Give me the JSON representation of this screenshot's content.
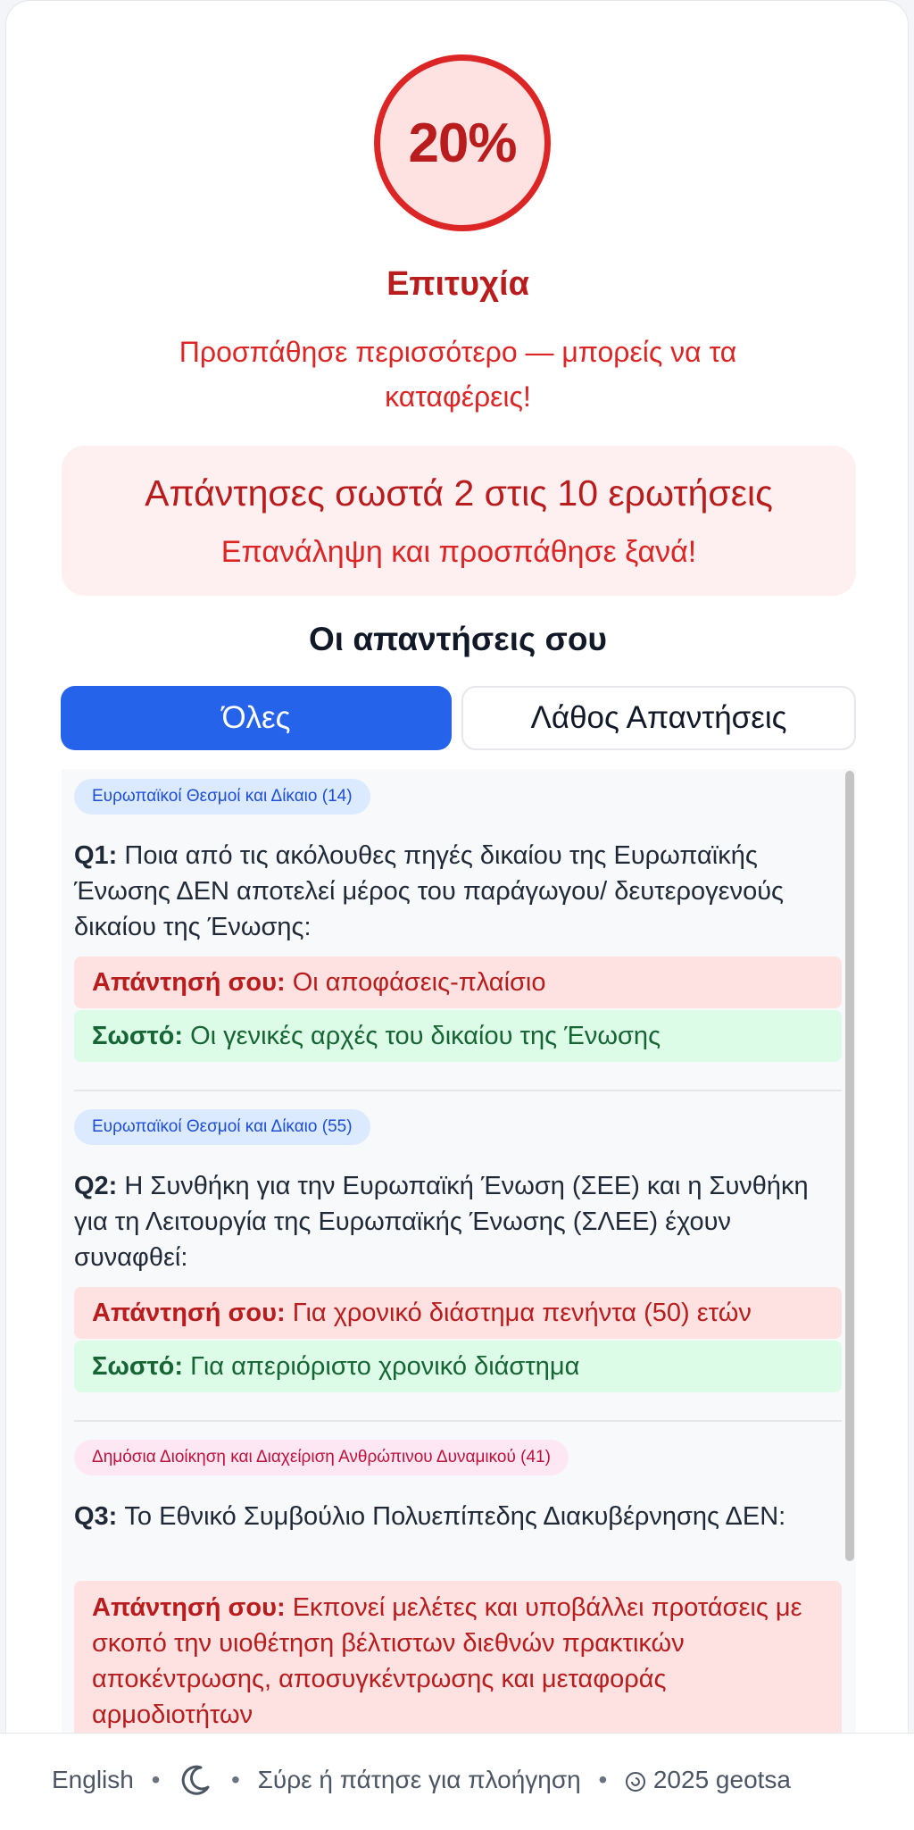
{
  "result": {
    "percent": "20%",
    "status": "Επιτυχία",
    "message": "Προσπάθησε περισσότερο — μπορείς να τα καταφέρεις!",
    "score_text": "Απάντησες σωστά 2 στις 10 ερωτήσεις",
    "score_sub": "Επανάληψη και προσπάθησε ξανά!",
    "score_fraction": 0.2,
    "accent_color": "#dc2626"
  },
  "answers": {
    "title": "Οι απαντήσεις σου",
    "tabs": [
      {
        "label": "Όλες",
        "active": true
      },
      {
        "label": "Λάθος Απαντήσεις",
        "active": false
      }
    ],
    "your_answer_label": "Απάντησή σου:",
    "correct_label": "Σωστό:",
    "items": [
      {
        "tag": "Ευρωπαϊκοί Θεσμοί και Δίκαιο (14)",
        "qnum": "Q1:",
        "question": "Ποια από τις ακόλουθες πηγές δικαίου της Ευρωπαϊκής Ένωσης ΔΕΝ αποτελεί μέρος του παράγωγου/ δευτερογενούς δικαίου της Ένωσης:",
        "your_answer": "Οι αποφάσεις-πλαίσιο",
        "correct": "Οι γενικές αρχές του δικαίου της Ένωσης"
      },
      {
        "tag": "Ευρωπαϊκοί Θεσμοί και Δίκαιο (55)",
        "qnum": "Q2:",
        "question": "Η Συνθήκη για την Ευρωπαϊκή Ένωση (ΣΕΕ) και η Συνθήκη για τη Λειτουργία της Ευρωπαϊκής Ένωσης (ΣΛΕΕ) έχουν συναφθεί:",
        "your_answer": "Για χρονικό διάστημα πενήντα (50) ετών",
        "correct": "Για απεριόριστο χρονικό διάστημα"
      },
      {
        "tag": "Δημόσια Διοίκηση και Διαχείριση Ανθρώπινου Δυναμικού (41)",
        "qnum": "Q3:",
        "question": "Το Εθνικό Συμβούλιο Πολυεπίπεδης Διακυβέρνησης ΔΕΝ:",
        "your_answer": "Εκπονεί μελέτες και υποβάλλει προτάσεις με σκοπό την υιοθέτηση βέλτιστων διεθνών πρακτικών αποκέντρωσης, αποσυγκέντρωσης και μεταφοράς αρμοδιοτήτων"
      }
    ]
  },
  "footer": {
    "language": "English",
    "theme_icon": "moon-icon",
    "hint": "Σύρε ή πάτησε για πλοήγηση",
    "copyright_icon": "spiral-logo-icon",
    "copyright": "2025 geotsa"
  }
}
